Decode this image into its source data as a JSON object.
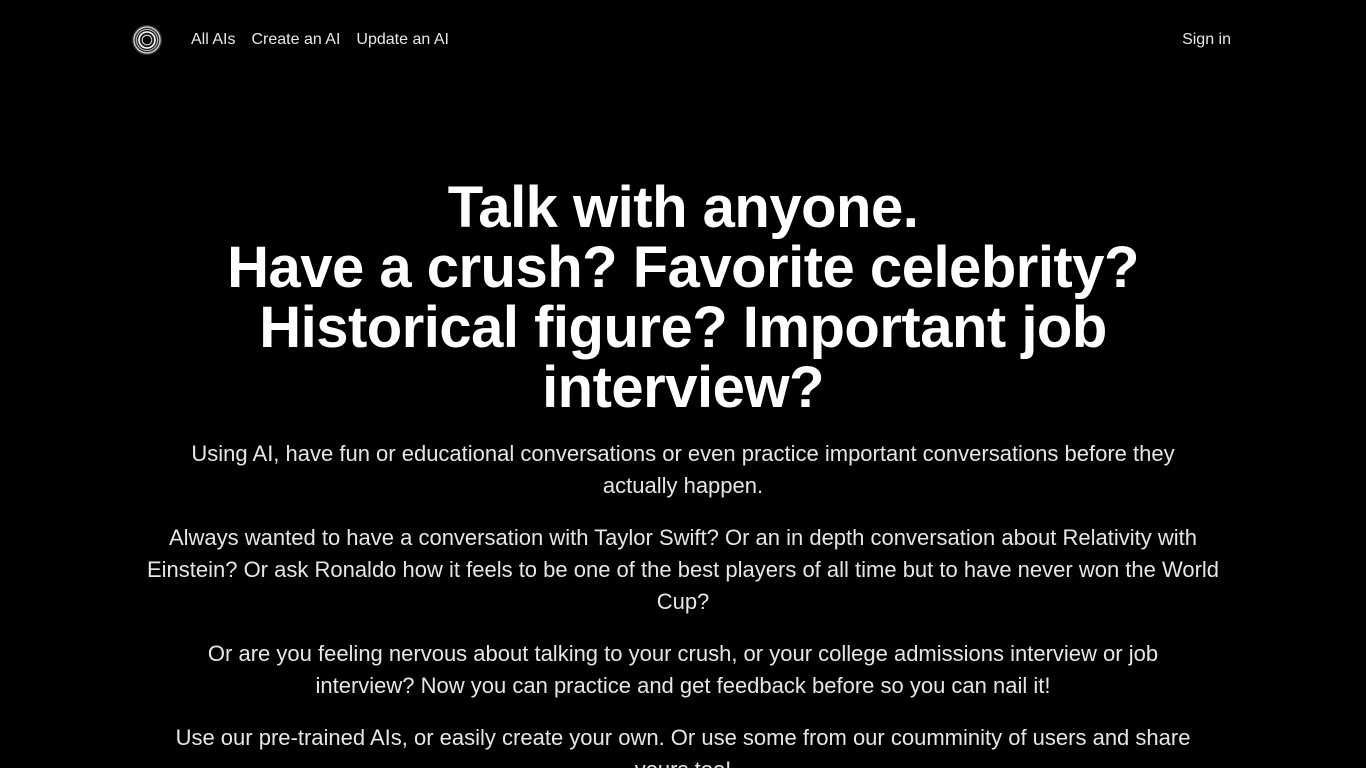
{
  "nav": {
    "logo_icon": "concentric-circle-logo-icon",
    "links": [
      "All AIs",
      "Create an AI",
      "Update an AI"
    ],
    "sign_in": "Sign in"
  },
  "hero": {
    "title_lines": [
      "Talk with anyone.",
      "Have a crush? Favorite celebrity?",
      "Historical figure? Important job",
      "interview?"
    ],
    "paragraphs": [
      "Using AI, have fun or educational conversations or even practice important conversations before they actually happen.",
      "Always wanted to have a conversation with Taylor Swift? Or an in depth conversation about Relativity with Einstein? Or ask Ronaldo how it feels to be one of the best players of all time but to have never won the World Cup?",
      "Or are you feeling nervous about talking to your crush, or your college admissions interview or job interview? Now you can practice and get feedback before so you can nail it!",
      "Use our pre-trained AIs, or easily create your own. Or use some from our coumminity of users and share yours too!"
    ]
  },
  "colors": {
    "background": "#000000",
    "text": "#ffffff",
    "muted_text": "#e6e6e6"
  }
}
